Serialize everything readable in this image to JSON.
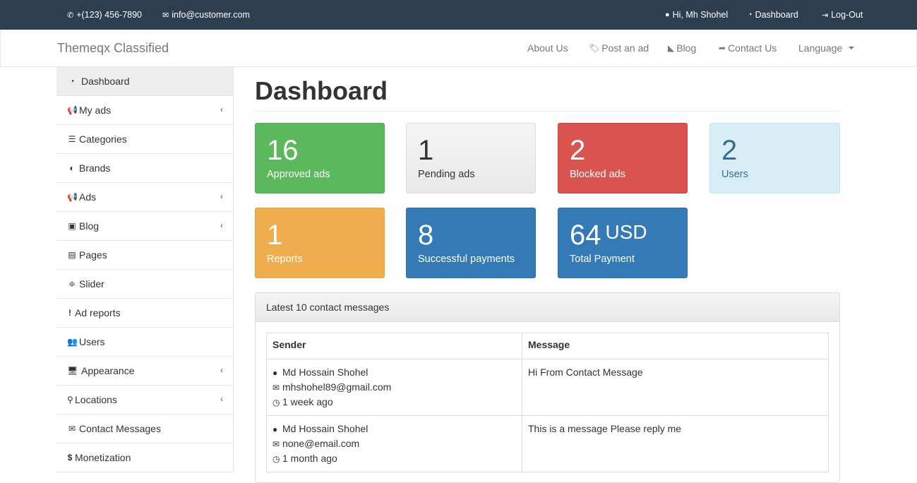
{
  "topbar": {
    "phone": "+(123) 456-7890",
    "email": "info@customer.com",
    "greeting": "Hi, Mh Shohel",
    "dashboard": "Dashboard",
    "logout": "Log-Out"
  },
  "navbar": {
    "brand": "Themeqx Classified",
    "about": "About Us",
    "post_ad": "Post an ad",
    "blog": "Blog",
    "contact": "Contact Us",
    "language": "Language"
  },
  "sidebar": {
    "items": [
      {
        "label": "Dashboard",
        "icon": "dashboard-icon",
        "submenu": false
      },
      {
        "label": "My ads",
        "icon": "bullhorn-icon",
        "submenu": true
      },
      {
        "label": "Categories",
        "icon": "list-icon",
        "submenu": false
      },
      {
        "label": "Brands",
        "icon": "adjust-icon",
        "submenu": false
      },
      {
        "label": "Ads",
        "icon": "bullhorn-icon",
        "submenu": true
      },
      {
        "label": "Blog",
        "icon": "rss-icon",
        "submenu": true
      },
      {
        "label": "Pages",
        "icon": "file-word-icon",
        "submenu": false
      },
      {
        "label": "Slider",
        "icon": "sliders-icon",
        "submenu": false
      },
      {
        "label": "Ad reports",
        "icon": "exclamation-icon",
        "submenu": false
      },
      {
        "label": "Users",
        "icon": "users-icon",
        "submenu": false
      },
      {
        "label": "Appearance",
        "icon": "desktop-icon",
        "submenu": true
      },
      {
        "label": "Locations",
        "icon": "map-marker-icon",
        "submenu": true
      },
      {
        "label": "Contact Messages",
        "icon": "envelope-icon",
        "submenu": false
      },
      {
        "label": "Monetization",
        "icon": "dollar-icon",
        "submenu": false
      }
    ]
  },
  "main": {
    "title": "Dashboard",
    "stats": [
      {
        "value": "16",
        "label": "Approved ads",
        "color": "#5cb85c"
      },
      {
        "value": "1",
        "label": "Pending ads",
        "color": "#eeeeee"
      },
      {
        "value": "2",
        "label": "Blocked ads",
        "color": "#d9534f"
      },
      {
        "value": "2",
        "label": "Users",
        "color": "#d9edf7"
      },
      {
        "value": "1",
        "label": "Reports",
        "color": "#f0ad4e"
      },
      {
        "value": "8",
        "label": "Successful payments",
        "color": "#337ab7"
      },
      {
        "value": "64",
        "unit": "USD",
        "label": "Total Payment",
        "color": "#337ab7"
      }
    ],
    "messages": {
      "heading": "Latest 10 contact messages",
      "col_sender": "Sender",
      "col_message": "Message",
      "rows": [
        {
          "name": "Md Hossain Shohel",
          "email": "mhshohel89@gmail.com",
          "time": "1 week ago",
          "message": "Hi From Contact Message"
        },
        {
          "name": "Md Hossain Shohel",
          "email": "none@email.com",
          "time": "1 month ago",
          "message": "This is a message Please reply me"
        }
      ]
    }
  }
}
